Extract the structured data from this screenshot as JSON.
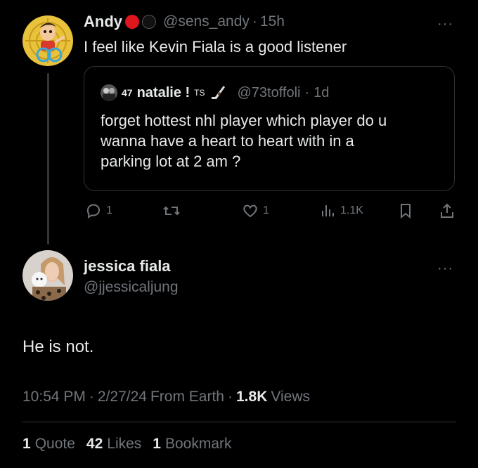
{
  "tweet": {
    "author_name": "Andy",
    "author_handle": "@sens_andy",
    "separator": "·",
    "time": "15h",
    "text": "I feel like Kevin Fiala is a good listener",
    "badge_colors": [
      "#e0161f",
      "#111111"
    ],
    "quote": {
      "prefix": "47",
      "author_name": "natalie !",
      "suffix": "TS",
      "author_handle": "@73toffoli",
      "separator": "·",
      "time": "1d",
      "text_lines": [
        "forget hottest nhl player which player do u",
        "wanna have a heart to heart with in a",
        "parking lot at 2 am ?"
      ]
    },
    "actions": {
      "replies": "1",
      "likes": "1",
      "views": "1.1K"
    }
  },
  "reply": {
    "author_name": "jessica fiala",
    "author_handle": "@jjessicaljung",
    "text": "He is not.",
    "meta": {
      "time": "10:54 PM",
      "sep1": "·",
      "date": "2/27/24",
      "source": "From Earth",
      "sep2": "·",
      "views_count": "1.8K",
      "views_label": "Views"
    },
    "stats": {
      "quotes_count": "1",
      "quotes_label": "Quote",
      "likes_count": "42",
      "likes_label": "Likes",
      "bookmarks_count": "1",
      "bookmarks_label": "Bookmark"
    }
  },
  "more_glyph": "···",
  "colors": {
    "background": "#000000",
    "text": "#e7e9ea",
    "muted": "#71767b",
    "border": "#2f3336"
  }
}
